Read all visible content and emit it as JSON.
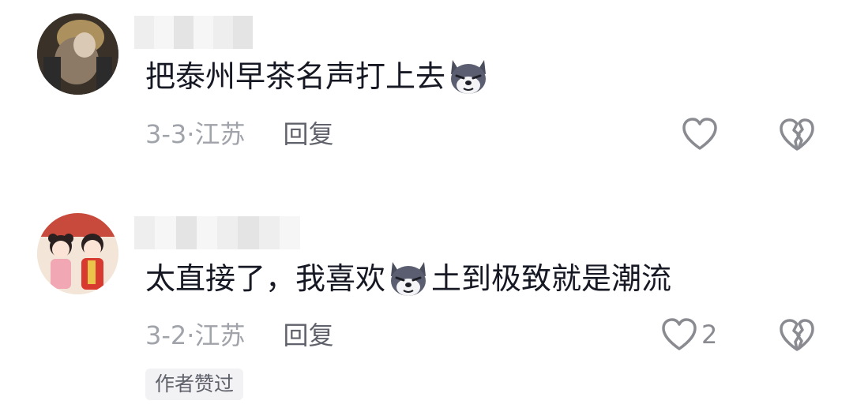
{
  "comments": [
    {
      "text_before": "把泰州早茶名声打上去",
      "emoji": "wolf-smirk-emoji",
      "text_after": "",
      "date": "3-3",
      "separator": "·",
      "location": "江苏",
      "reply_label": "回复",
      "like_count": ""
    },
    {
      "text_before": "太直接了，我喜欢",
      "emoji": "wolf-smirk-emoji",
      "text_after": "土到极致就是潮流",
      "date": "3-2",
      "separator": "·",
      "location": "江苏",
      "reply_label": "回复",
      "like_count": "2",
      "author_badge": "作者赞过"
    }
  ],
  "colors": {
    "text": "#161823",
    "meta": "#a1a3aa",
    "reply": "#60626b",
    "icon": "#8a8b91",
    "badge_bg": "#f2f2f4"
  }
}
